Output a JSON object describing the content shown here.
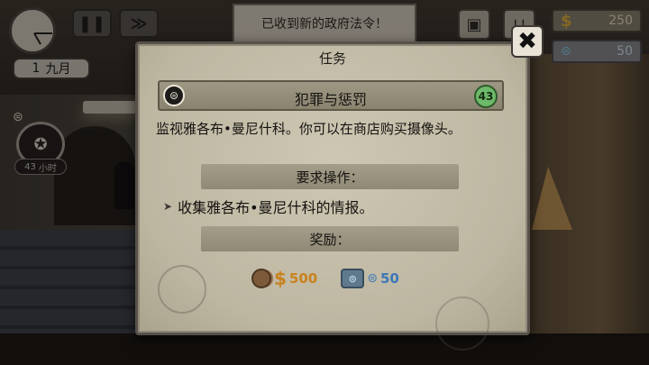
{
  "hud": {
    "date_day": "1",
    "date_month": "九月",
    "notification": "已收到新的政府法令！",
    "money": "250",
    "reputation": "50",
    "badge_timer_value": "43",
    "badge_timer_unit": "小时",
    "pause_glyph": "❚❚",
    "fast_forward_glyph": "≫",
    "money_symbol": "$",
    "reputation_symbol": "⊜"
  },
  "modal": {
    "title": "任务",
    "quest_name": "犯罪与惩罚",
    "quest_level": "43",
    "description": "监视雅各布•曼尼什科。你可以在商店购买摄像头。",
    "requirements_header": "要求操作：",
    "task": "收集雅各布•曼尼什科的情报。",
    "rewards_header": "奖励：",
    "reward_money_symbol": "$",
    "reward_money": "500",
    "reward_reputation_symbol": "⊜",
    "reward_reputation": "50",
    "close_glyph": "✖"
  },
  "colors": {
    "money": "#c9821e",
    "reputation": "#3d78b8",
    "level_badge": "#6fb96a"
  },
  "icons": {
    "clock": "clock-icon",
    "pause": "pause-icon",
    "fast_forward": "fast-forward-icon",
    "bag": "bag-icon",
    "shop": "shop-cart-icon",
    "police": "police-badge-icon",
    "close": "close-icon"
  }
}
